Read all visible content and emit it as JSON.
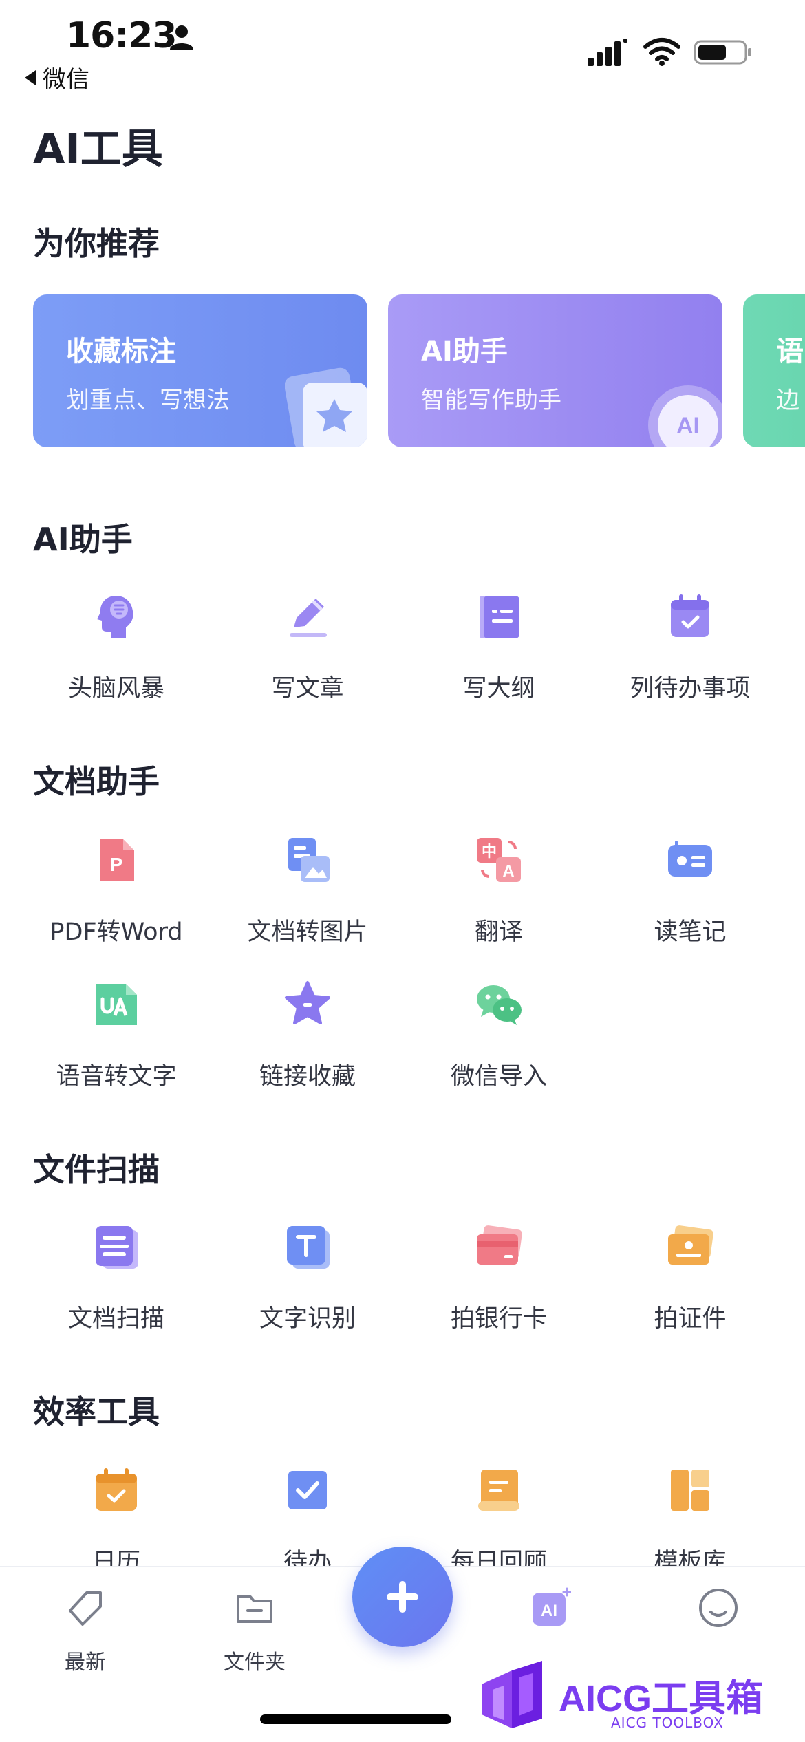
{
  "status_bar": {
    "time": "16:23",
    "back_app": "微信"
  },
  "page_title": "AI工具",
  "sections": {
    "recommend": "为你推荐",
    "ai_assistant": "AI助手",
    "doc_assistant": "文档助手",
    "file_scan": "文件扫描",
    "efficiency": "效率工具"
  },
  "recommend_cards": [
    {
      "title": "收藏标注",
      "subtitle": "划重点、写想法",
      "color_start": "#7e9cf6",
      "color_end": "#6f8cf0"
    },
    {
      "title": "AI助手",
      "subtitle": "智能写作助手",
      "color_start": "#a89af5",
      "color_end": "#9382ef"
    },
    {
      "title": "语",
      "subtitle": "边",
      "color_start": "#6fd9b4",
      "color_end": "#5bcfa6"
    }
  ],
  "ai_tools": [
    {
      "label": "头脑风暴",
      "icon": "brain-icon"
    },
    {
      "label": "写文章",
      "icon": "pencil-icon"
    },
    {
      "label": "写大纲",
      "icon": "outline-book-icon"
    },
    {
      "label": "列待办事项",
      "icon": "todo-calendar-icon"
    }
  ],
  "doc_tools": [
    {
      "label": "PDF转Word",
      "icon": "pdf-icon"
    },
    {
      "label": "文档转图片",
      "icon": "doc-to-image-icon"
    },
    {
      "label": "翻译",
      "icon": "translate-icon"
    },
    {
      "label": "读笔记",
      "icon": "read-note-icon"
    },
    {
      "label": "语音转文字",
      "icon": "voice-to-text-icon"
    },
    {
      "label": "链接收藏",
      "icon": "star-bookmark-icon"
    },
    {
      "label": "微信导入",
      "icon": "wechat-icon"
    }
  ],
  "scan_tools": [
    {
      "label": "文档扫描",
      "icon": "doc-scan-icon"
    },
    {
      "label": "文字识别",
      "icon": "text-ocr-icon"
    },
    {
      "label": "拍银行卡",
      "icon": "bank-card-icon"
    },
    {
      "label": "拍证件",
      "icon": "id-card-icon"
    }
  ],
  "efficiency_tools": [
    {
      "label": "日历",
      "icon": "calendar-icon"
    },
    {
      "label": "待办",
      "icon": "checkbox-icon"
    },
    {
      "label": "每日回顾",
      "icon": "daily-review-icon"
    },
    {
      "label": "模板库",
      "icon": "template-icon"
    }
  ],
  "tab_bar": {
    "items": [
      {
        "label": "最新",
        "icon": "tag-icon"
      },
      {
        "label": "文件夹",
        "icon": "folder-icon"
      },
      {
        "label": "",
        "icon": "ai-tools-icon"
      },
      {
        "label": "",
        "icon": "profile-smile-icon"
      }
    ],
    "fab_icon": "plus-icon"
  },
  "watermark": {
    "title": "AICG工具箱",
    "subtitle": "AICG TOOLBOX"
  },
  "colors": {
    "accent_blue": "#6f8cf0",
    "accent_purple": "#9382ef",
    "accent_green": "#5bcfa6",
    "text_primary": "#1f2230",
    "text_secondary": "#333642",
    "watermark_purple": "#7b3df0"
  }
}
